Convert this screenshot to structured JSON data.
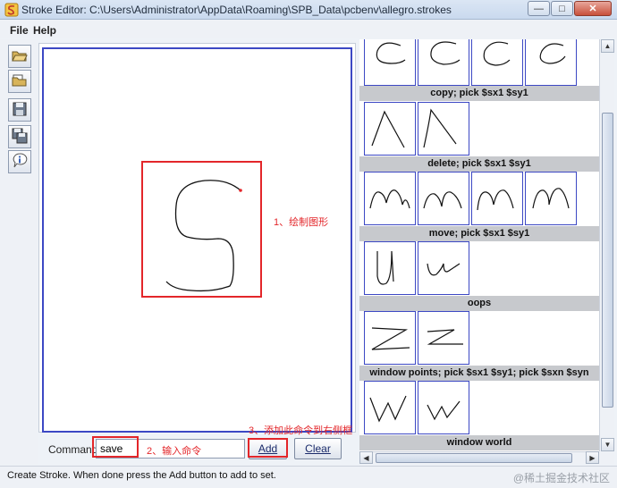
{
  "window": {
    "title": "Stroke Editor: C:\\Users\\Administrator\\AppData\\Roaming\\SPB_Data\\pcbenv\\allegro.strokes",
    "minimize": "—",
    "maximize": "□",
    "close": "✕"
  },
  "menu": {
    "file": "File",
    "help": "Help"
  },
  "toolbar": {
    "icons": [
      "folder-open-icon",
      "folder-icon",
      "save-icon",
      "save-as-icon",
      "info-icon"
    ]
  },
  "command": {
    "label": "Command:",
    "value": "save",
    "add_label": "Add",
    "clear_label": "Clear"
  },
  "annotations": {
    "step1": "1、绘制图形",
    "step2": "2、输入命令",
    "step3": "3、添加此命令到右侧框",
    "color": "#e3262a"
  },
  "gestures": [
    {
      "label": "copy; pick $sx1 $sy1",
      "shape": "c",
      "count": 4
    },
    {
      "label": "delete; pick $sx1 $sy1",
      "shape": "lambda",
      "count": 2
    },
    {
      "label": "move; pick $sx1 $sy1",
      "shape": "m",
      "count": 4
    },
    {
      "label": "oops",
      "shape": "u",
      "count": 2
    },
    {
      "label": "window points; pick $sx1 $sy1; pick $sxn $syn",
      "shape": "z",
      "count": 2
    },
    {
      "label": "window world",
      "shape": "w",
      "count": 2
    }
  ],
  "status": {
    "text": "Create Stroke. When done press the Add button to add to set.",
    "watermark": "@稀土掘金技术社区"
  },
  "colors": {
    "canvas_border": "#3c48c4",
    "highlight": "#e3262a",
    "label_bar": "#c7c9cd"
  }
}
